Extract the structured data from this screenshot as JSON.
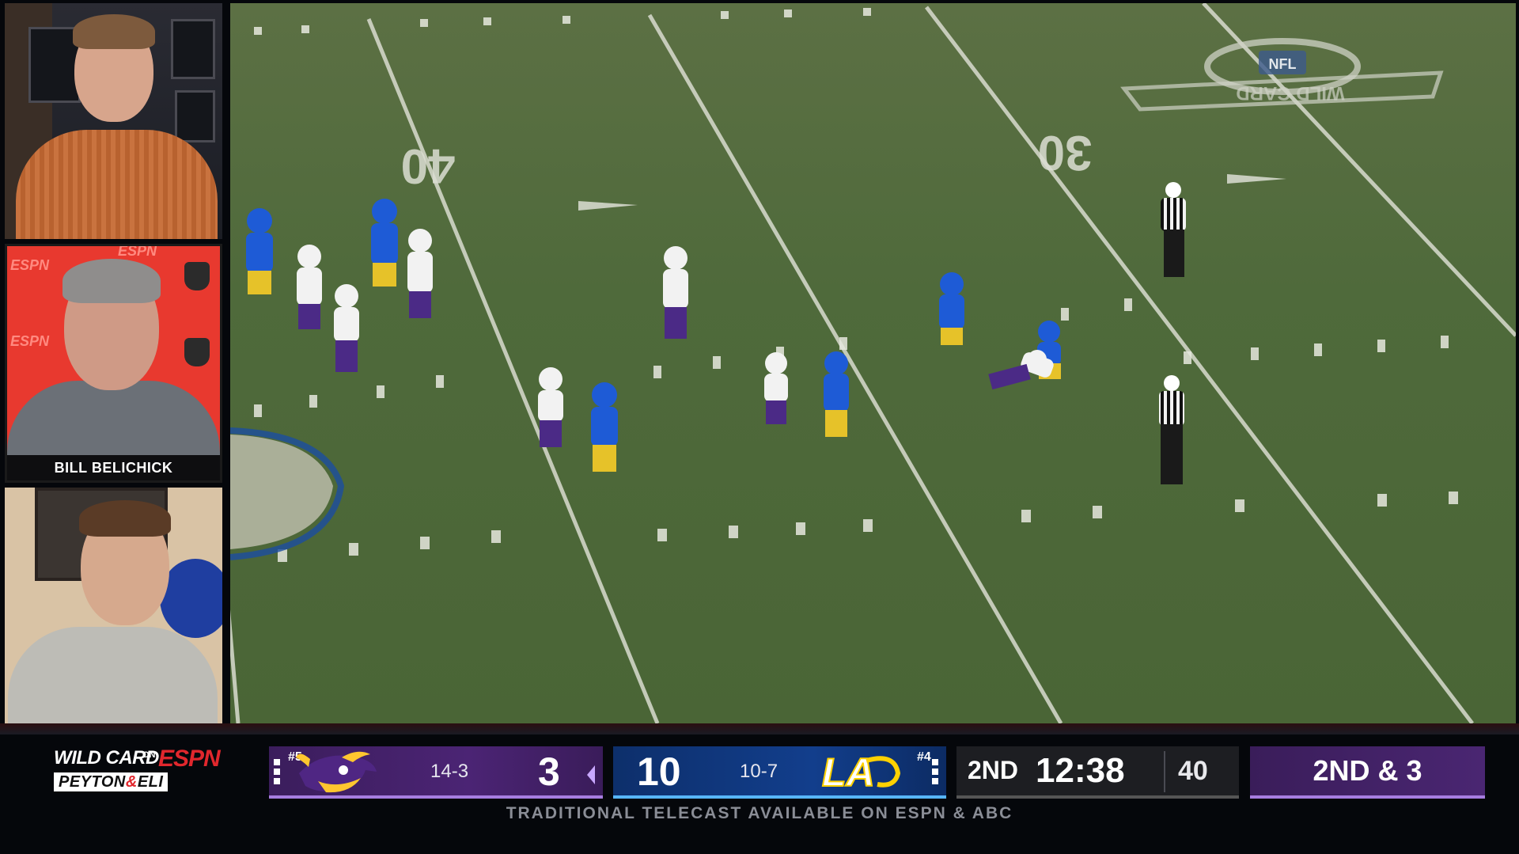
{
  "cameras": {
    "top": {
      "label": ""
    },
    "middle": {
      "nameplate": "BILL BELICHICK",
      "wall_logo": "ESPN"
    },
    "bottom": {
      "label": ""
    }
  },
  "field": {
    "yard_numbers": [
      "40",
      "30"
    ],
    "midfield_logo_text": "NFL",
    "wild_card_text": "WILD CARD"
  },
  "branding": {
    "line1": "WILD CARD",
    "on": "ON",
    "network": "ESPN",
    "line2_a": "PEYTON",
    "line2_amp": "&",
    "line2_b": "ELI"
  },
  "away_team": {
    "rank": "#5",
    "record": "14-3",
    "score": "3",
    "color": "#4b2474"
  },
  "home_team": {
    "rank": "#4",
    "record": "10-7",
    "score": "10",
    "color": "#123e8c"
  },
  "game_clock": {
    "quarter": "2ND",
    "clock": "12:38",
    "play_clock": "40"
  },
  "down_distance": "2ND & 3",
  "ticker": "TRADITIONAL TELECAST AVAILABLE ON ESPN & ABC"
}
